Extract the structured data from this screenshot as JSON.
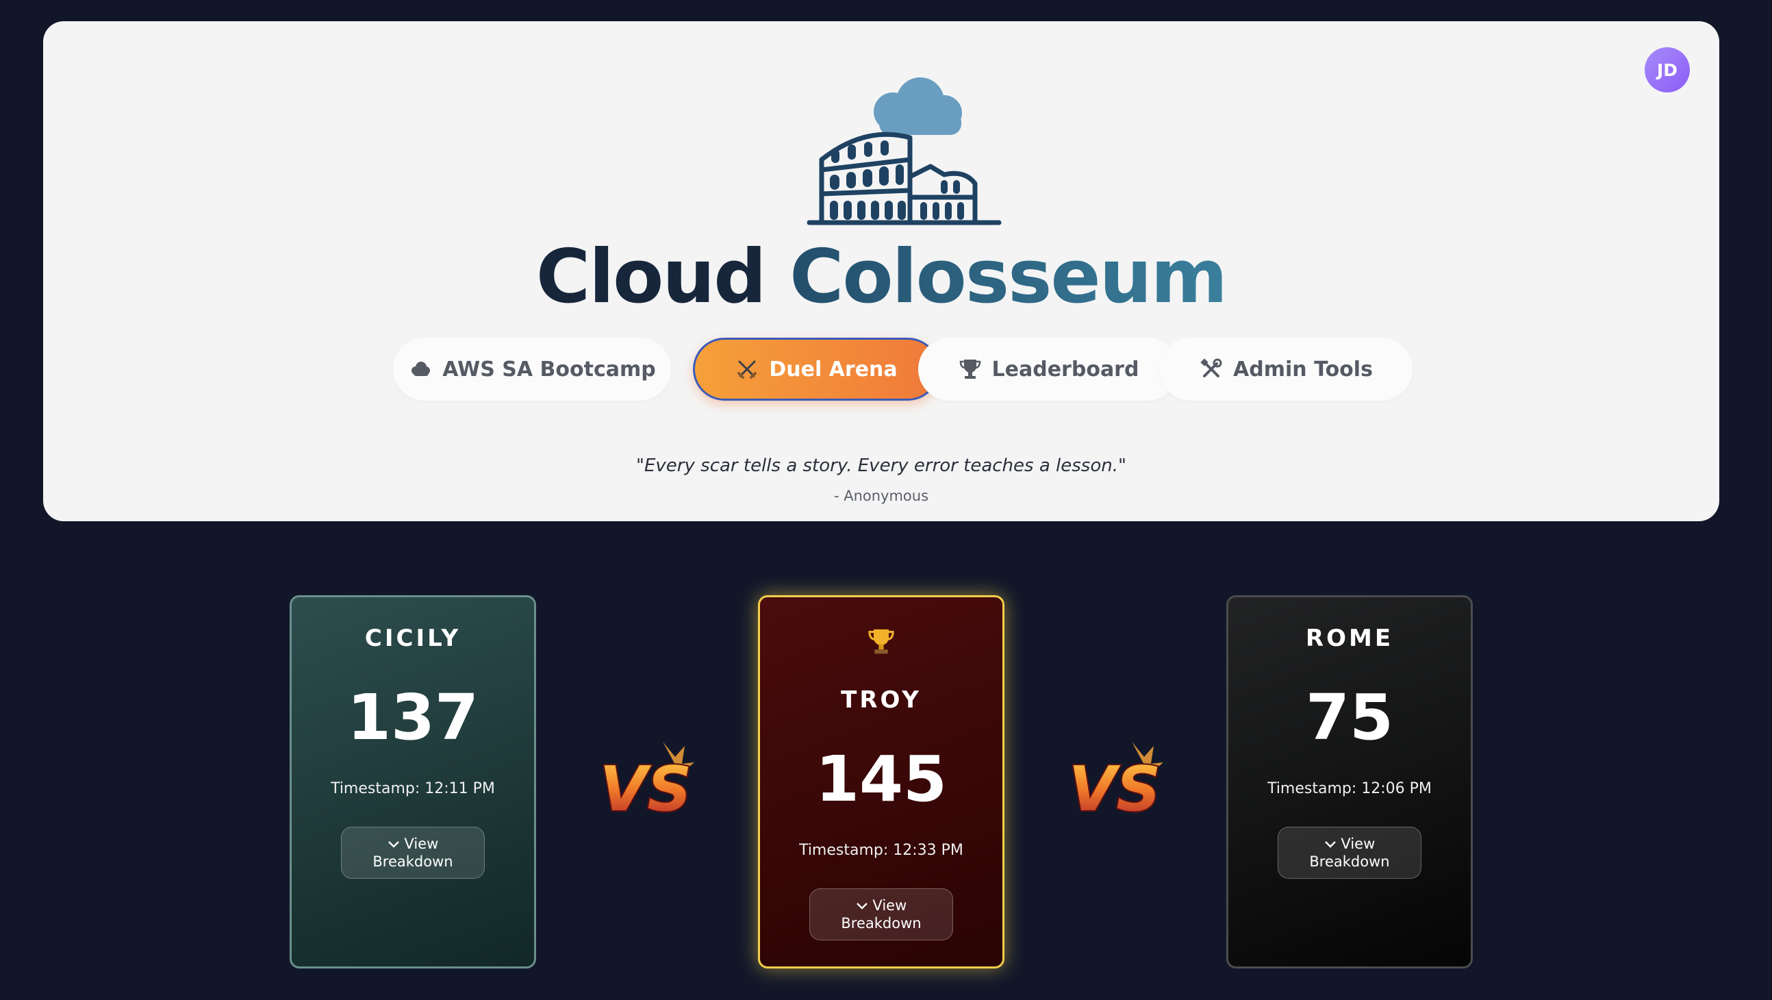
{
  "header": {
    "avatar_initials": "JD",
    "title_part1": "Cloud",
    "title_part2": "Colosseum",
    "nav": [
      {
        "label": "AWS SA Bootcamp",
        "icon": "cloud-icon",
        "active": false
      },
      {
        "label": "Duel Arena",
        "icon": "crossed-swords-icon",
        "active": true
      },
      {
        "label": "Leaderboard",
        "icon": "trophy-icon",
        "active": false
      },
      {
        "label": "Admin Tools",
        "icon": "tools-icon",
        "active": false
      }
    ],
    "quote": "\"Every scar tells a story. Every error teaches a lesson.\"",
    "quote_author": "- Anonymous"
  },
  "arena": {
    "vs_label": "VS",
    "teams": [
      {
        "name": "CICILY",
        "score": "137",
        "timestamp": "Timestamp: 12:11 PM",
        "button_line1": "View",
        "button_line2": "Breakdown",
        "leader": false
      },
      {
        "name": "TROY",
        "score": "145",
        "timestamp": "Timestamp: 12:33 PM",
        "button_line1": "View",
        "button_line2": "Breakdown",
        "leader": true,
        "leader_icon": "trophy-icon"
      },
      {
        "name": "ROME",
        "score": "75",
        "timestamp": "Timestamp: 12:06 PM",
        "button_line1": "View",
        "button_line2": "Breakdown",
        "leader": false
      }
    ]
  },
  "colors": {
    "background": "#111729",
    "accent": "#f5a03a",
    "leader_border": "#f2cf4a"
  }
}
